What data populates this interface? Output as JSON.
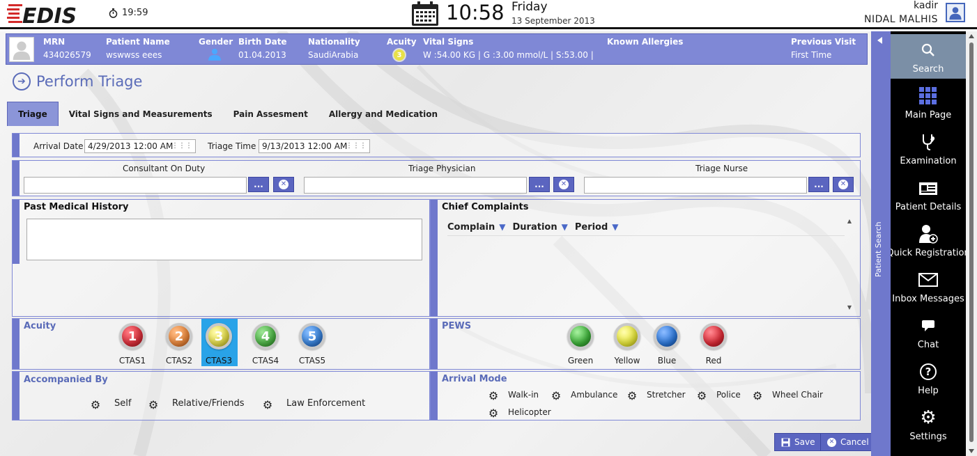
{
  "header": {
    "logo_text": "EDIS",
    "small_time": "19:59",
    "big_time": "10:58",
    "day_name": "Friday",
    "full_date": "13 September 2013",
    "user_first": "kadir",
    "user_full": "NIDAL  MALHIS"
  },
  "patient": {
    "mrn_label": "MRN",
    "mrn": "434026579",
    "name_label": "Patient Name",
    "name": "wswwss eees",
    "gender_label": "Gender",
    "birth_label": "Birth Date",
    "birth": "01.04.2013",
    "nationality_label": "Nationality",
    "nationality": "SaudiArabia",
    "acuity_label": "Acuity",
    "acuity": "3",
    "vitals_label": "Vital Signs",
    "vitals": "W :54.00 KG | G :3.00 mmol/L  |  S:53.00 |",
    "allergies_label": "Known Allergies",
    "prev_label": "Previous Visit",
    "prev": "First Time"
  },
  "page_title": "Perform Triage",
  "tabs": [
    {
      "label": "Triage",
      "active": true
    },
    {
      "label": "Vital Signs and Measurements"
    },
    {
      "label": "Pain Assesment"
    },
    {
      "label": "Allergy and Medication"
    }
  ],
  "arrival": {
    "arrival_label": "Arrival Date",
    "arrival_value": "4/29/2013 12:00 AM",
    "triage_label": "Triage Time",
    "triage_value": "9/13/2013 12:00 AM"
  },
  "staff": {
    "consultant_label": "Consultant On Duty",
    "physician_label": "Triage Physician",
    "nurse_label": "Triage Nurse",
    "lookup_label": "..."
  },
  "history": {
    "title": "Past Medical History"
  },
  "complaints": {
    "title": "Chief Complaints",
    "columns": [
      "Complain",
      "Duration",
      "Period"
    ]
  },
  "acuity": {
    "title": "Acuity",
    "levels": [
      {
        "num": "1",
        "label": "CTAS1",
        "color": "#e0303c"
      },
      {
        "num": "2",
        "label": "CTAS2",
        "color": "#ef8a3c"
      },
      {
        "num": "3",
        "label": "CTAS3",
        "color": "#e8e048",
        "selected": true
      },
      {
        "num": "4",
        "label": "CTAS4",
        "color": "#4fb848"
      },
      {
        "num": "5",
        "label": "CTAS5",
        "color": "#3a86e0"
      }
    ]
  },
  "pews": {
    "title": "PEWS",
    "levels": [
      {
        "label": "Green",
        "color": "#3eb53a"
      },
      {
        "label": "Yellow",
        "color": "#ecec3a"
      },
      {
        "label": "Blue",
        "color": "#2d7be0"
      },
      {
        "label": "Red",
        "color": "#e02a36"
      }
    ]
  },
  "accompanied": {
    "title": "Accompanied By",
    "options": [
      "Self",
      "Relative/Friends",
      "Law Enforcement"
    ]
  },
  "arrival_mode": {
    "title": "Arrival Mode",
    "options": [
      "Walk-in",
      "Ambulance",
      "Stretcher",
      "Police",
      "Wheel Chair",
      "Helicopter"
    ]
  },
  "actions": {
    "save": "Save",
    "cancel": "Cancel"
  },
  "patient_search_label": "Patient Search",
  "nav": [
    {
      "label": "Search",
      "icon": "search-icon"
    },
    {
      "label": "Main Page",
      "icon": "grid-icon"
    },
    {
      "label": "Examination",
      "icon": "stethoscope-icon"
    },
    {
      "label": "Patient Details",
      "icon": "id-card-icon"
    },
    {
      "label": "Quick Registration",
      "icon": "add-user-icon"
    },
    {
      "label": "Inbox Messages",
      "icon": "envelope-icon"
    },
    {
      "label": "Chat",
      "icon": "chat-icon"
    },
    {
      "label": "Help",
      "icon": "help-icon"
    },
    {
      "label": "Settings",
      "icon": "gear-icon"
    }
  ]
}
